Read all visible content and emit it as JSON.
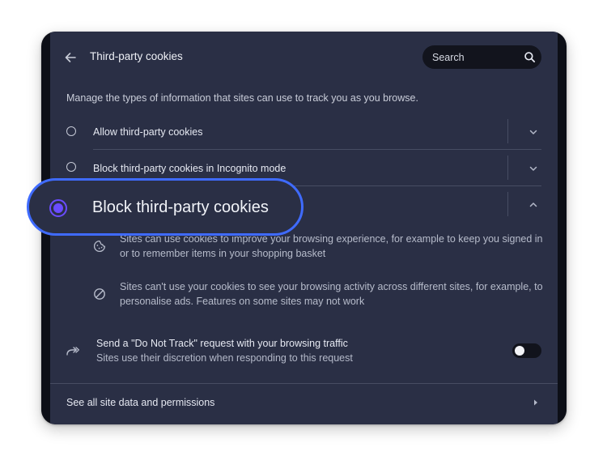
{
  "header": {
    "title": "Third-party cookies",
    "search_placeholder": "Search"
  },
  "description": "Manage the types of information that sites can use to track you as you browse.",
  "options": [
    {
      "label": "Allow third-party cookies",
      "selected": false,
      "expanded": false
    },
    {
      "label": "Block third-party cookies in Incognito mode",
      "selected": false,
      "expanded": false
    },
    {
      "label": "Block third-party cookies",
      "selected": true,
      "expanded": true
    }
  ],
  "expanded_details": [
    {
      "icon": "cookie-icon",
      "text": "Sites can use cookies to improve your browsing experience, for example to keep you signed in or to remember items in your shopping basket"
    },
    {
      "icon": "block-icon",
      "text": "Sites can't use your cookies to see your browsing activity across different sites, for example, to personalise ads. Features on some sites may not work"
    }
  ],
  "do_not_track": {
    "title": "Send a \"Do Not Track\" request with your browsing traffic",
    "subtitle": "Sites use their discretion when responding to this request",
    "enabled": false
  },
  "footer_link": "See all site data and permissions",
  "colors": {
    "panel_bg": "#2a2f45",
    "highlight_border": "#3f6bff",
    "radio_selected": "#6a4cff"
  }
}
